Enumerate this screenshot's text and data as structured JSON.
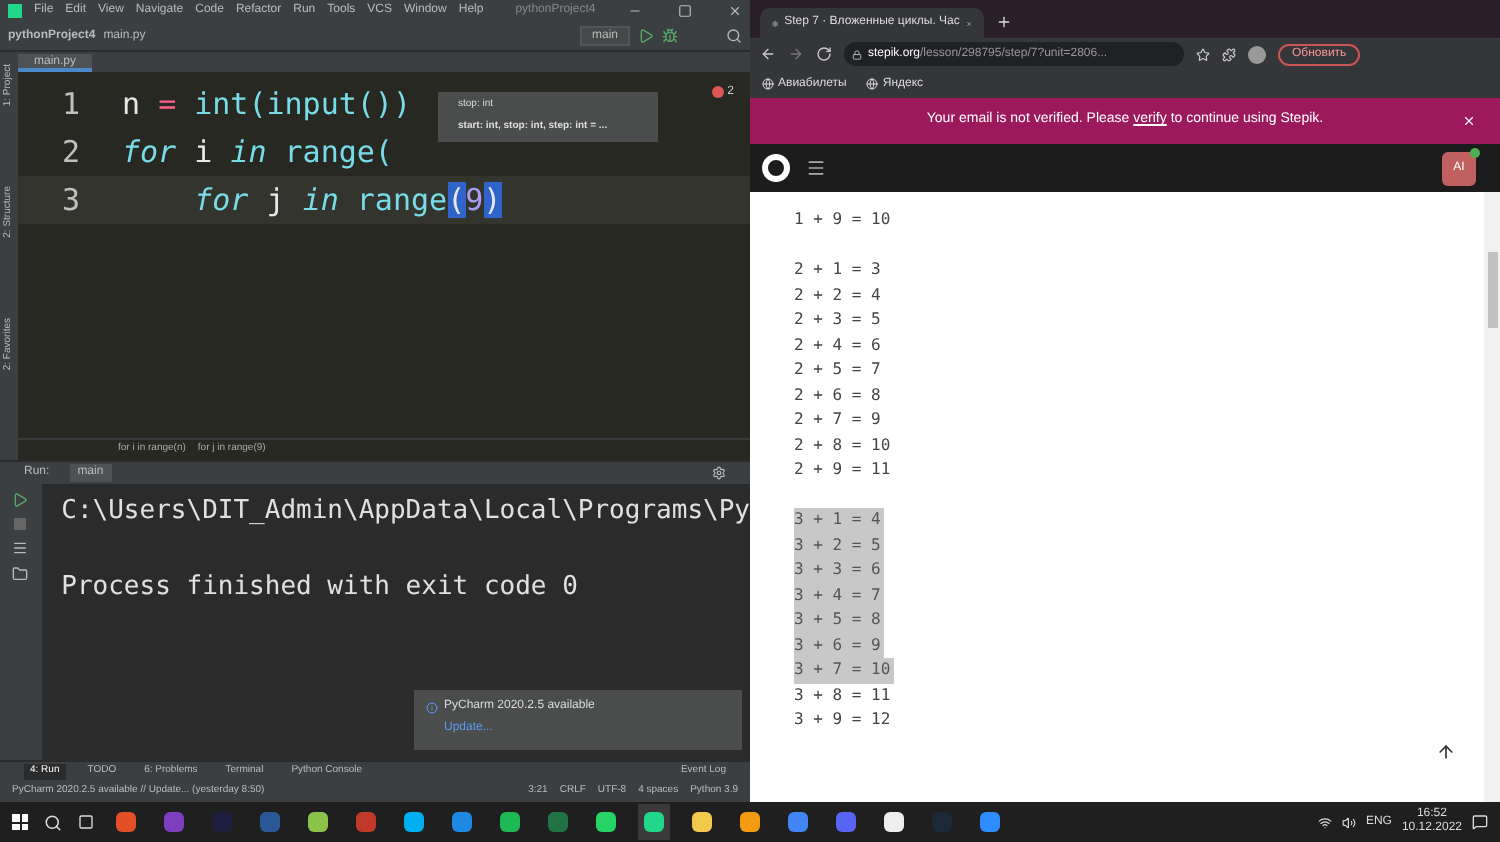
{
  "ide": {
    "menu": [
      "File",
      "Edit",
      "View",
      "Navigate",
      "Code",
      "Refactor",
      "Run",
      "Tools",
      "VCS",
      "Window",
      "Help"
    ],
    "window_title": "pythonProject4",
    "breadcrumbs": [
      "pythonProject4",
      "main.py"
    ],
    "run_config": "main",
    "editor_tabs": [
      {
        "label": "main.py",
        "selected": true
      }
    ],
    "side_labels": [
      "1: Project",
      "2: Structure",
      "2: Favorites"
    ],
    "problems_count": "2",
    "code_lines": [
      {
        "number": "1",
        "current": false,
        "tokens": [
          {
            "text": "n ",
            "kind": "name"
          },
          {
            "text": "=",
            "kind": "op"
          },
          {
            "text": " int(input())",
            "kind": "call"
          }
        ]
      },
      {
        "number": "2",
        "current": false,
        "tokens": [
          {
            "text": "for",
            "kind": "keyword"
          },
          {
            "text": " i ",
            "kind": "name"
          },
          {
            "text": "in",
            "kind": "keyword"
          },
          {
            "text": " range(",
            "kind": "call"
          }
        ]
      },
      {
        "number": "3",
        "current": true,
        "tokens": [
          {
            "text": "    for",
            "kind": "keyword"
          },
          {
            "text": " j ",
            "kind": "name"
          },
          {
            "text": "in",
            "kind": "keyword"
          },
          {
            "text": " range",
            "kind": "call"
          },
          {
            "text": "(",
            "kind": "match"
          },
          {
            "text": "9",
            "kind": "number"
          },
          {
            "text": ")",
            "kind": "match"
          }
        ]
      }
    ],
    "param_hint": [
      "stop: int",
      "start: int, stop: int, step: int = ..."
    ],
    "code_path": [
      "for i in range(n)",
      "for j in range(9)"
    ],
    "run_label": "Run:",
    "run_tab": "main",
    "console": [
      "C:\\Users\\DIT_Admin\\AppData\\Local\\Programs\\Py",
      "Process finished with exit code 0"
    ],
    "notification": {
      "title": "PyCharm 2020.2.5 available",
      "link": "Update..."
    },
    "tool_windows": [
      {
        "label": "4: Run",
        "selected": true
      },
      {
        "label": "TODO",
        "selected": false
      },
      {
        "label": "6: Problems",
        "selected": false
      },
      {
        "label": "Terminal",
        "selected": false
      },
      {
        "label": "Python Console",
        "selected": false
      }
    ],
    "event_log": "Event Log",
    "status_message": "PyCharm 2020.2.5 available // Update... (yesterday 8:50)",
    "status_items": [
      "3:21",
      "CRLF",
      "UTF-8",
      "4 spaces",
      "Python 3.9"
    ]
  },
  "browser": {
    "tab_title": "Step 7 · Вложенные циклы. Час",
    "url_host": "stepik.org",
    "url_path": "/lesson/298795/step/7?unit=2806...",
    "update_button": "Обновить",
    "bookmarks": [
      "Авиабилеты",
      "Яндекс"
    ],
    "banner": {
      "before": "Your email is not verified. Please ",
      "link": "verify",
      "after": " to continue using Stepik."
    },
    "avatar": "AI",
    "output_blocks": [
      [
        {
          "text": "1 + 9 = 10",
          "selected": false
        }
      ],
      [
        {
          "text": "2 + 1 = 3",
          "selected": false
        },
        {
          "text": "2 + 2 = 4",
          "selected": false
        },
        {
          "text": "2 + 3 = 5",
          "selected": false
        },
        {
          "text": "2 + 4 = 6",
          "selected": false
        },
        {
          "text": "2 + 5 = 7",
          "selected": false
        },
        {
          "text": "2 + 6 = 8",
          "selected": false
        },
        {
          "text": "2 + 7 = 9",
          "selected": false
        },
        {
          "text": "2 + 8 = 10",
          "selected": false
        },
        {
          "text": "2 + 9 = 11",
          "selected": false
        }
      ],
      [
        {
          "text": "3 + 1 = 4",
          "selected": true
        },
        {
          "text": "3 + 2 = 5",
          "selected": true
        },
        {
          "text": "3 + 3 = 6",
          "selected": true
        },
        {
          "text": "3 + 4 = 7",
          "selected": true
        },
        {
          "text": "3 + 5 = 8",
          "selected": true
        },
        {
          "text": "3 + 6 = 9",
          "selected": true
        },
        {
          "text": "3 + 7 = 10",
          "selected": true
        },
        {
          "text": "3 + 8 = 11",
          "selected": false
        },
        {
          "text": "3 + 9 = 12",
          "selected": false
        }
      ]
    ]
  },
  "taskbar": {
    "apps": [
      {
        "color": "#e34f26",
        "active": false
      },
      {
        "color": "#7b3fbf",
        "active": false
      },
      {
        "color": "#1e1e3f",
        "active": false
      },
      {
        "color": "#2b5797",
        "active": false
      },
      {
        "color": "#8bc34a",
        "active": false
      },
      {
        "color": "#c0392b",
        "active": false
      },
      {
        "color": "#00aff0",
        "active": false
      },
      {
        "color": "#1e88e5",
        "active": false
      },
      {
        "color": "#1db954",
        "active": false
      },
      {
        "color": "#217346",
        "active": false
      },
      {
        "color": "#25d366",
        "active": false
      },
      {
        "color": "#21d789",
        "active": true
      },
      {
        "color": "#f2c94c",
        "active": false
      },
      {
        "color": "#f39c12",
        "active": false
      },
      {
        "color": "#4285f4",
        "active": false
      },
      {
        "color": "#5865f2",
        "active": false
      },
      {
        "color": "#eeeeee",
        "active": false
      },
      {
        "color": "#1b2838",
        "active": false
      },
      {
        "color": "#2d8cff",
        "active": false
      }
    ],
    "language": "ENG",
    "time": "16:52",
    "date": "10.12.2022"
  }
}
